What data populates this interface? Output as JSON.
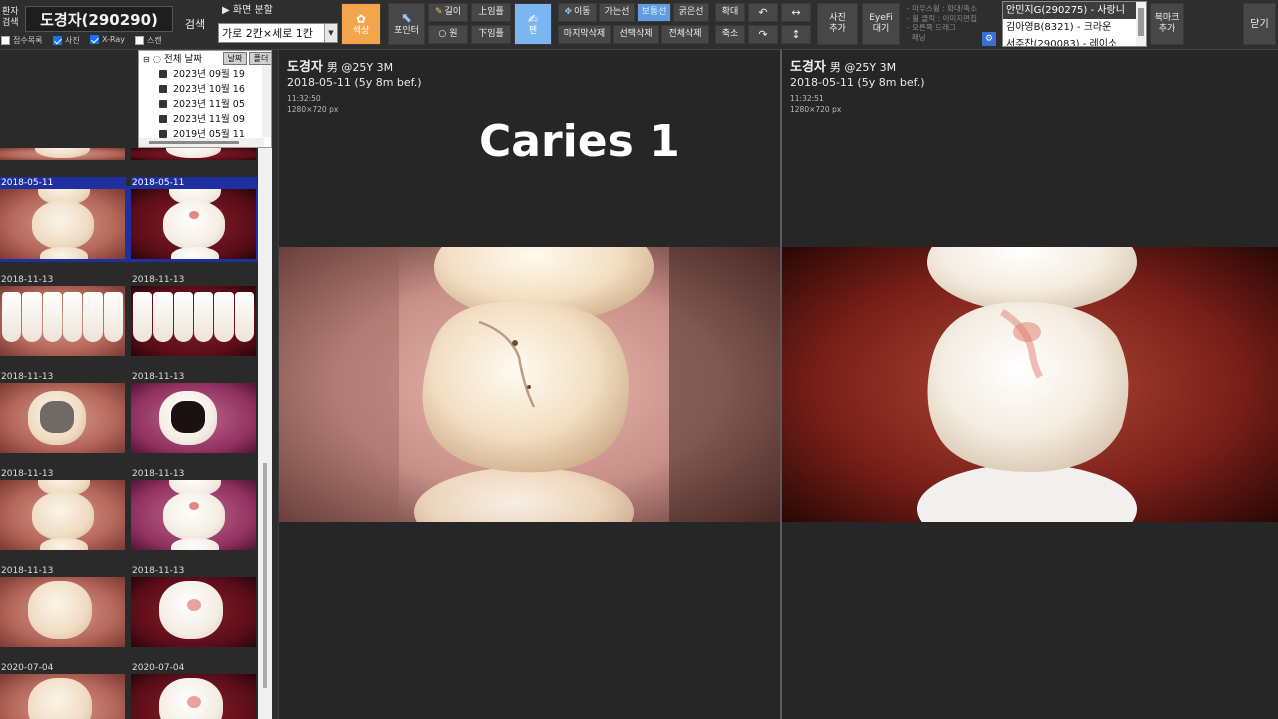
{
  "toolbar": {
    "patient_search_label": "환자\n검색",
    "patient_name": "도경자(290290)",
    "search_button": "검색",
    "checkboxes": [
      {
        "label": "접수목록",
        "checked": false
      },
      {
        "label": "사진",
        "checked": true
      },
      {
        "label": "X-Ray",
        "checked": true
      },
      {
        "label": "스캔",
        "checked": false
      }
    ],
    "split_label": "▶ 화면 분할",
    "split_value": "가로 2칸×세로 1칸",
    "color_button": "색상",
    "pointer_button": "포인터",
    "length_button": "길이",
    "circle_button": "원",
    "up_open_button": "上임플",
    "down_open_button": "下임플",
    "pen_button": "펜",
    "move_button": "이동",
    "thin_line_button": "가는선",
    "normal_line_button": "보통선",
    "thick_line_button": "굵은선",
    "delete_last_button": "마지막삭제",
    "delete_selected_button": "선택삭제",
    "delete_all_button": "전체삭제",
    "zoom_in_button": "확대",
    "zoom_out_button": "축소",
    "rotate_ccw_glyph": "↶",
    "rotate_cw_glyph": "↷",
    "flip_h_glyph": "↔",
    "flip_v_glyph": "↕",
    "add_photo_button": "사진\n추가",
    "eyefi_button": "EyeFi\n대기",
    "hint_lines": [
      "- 마우스휠 : 확대/축소",
      "- 휠 클릭 : 이미지편집",
      "- 오른쪽 드래그",
      "  패닝"
    ],
    "hint_gear_glyph": "⚙",
    "queue": [
      {
        "label": "안민지G(290275) - 사랑니",
        "selected": true
      },
      {
        "label": "김아영B(8321) - 크라운",
        "selected": false
      },
      {
        "label": "서주찬(290083) - 레이소",
        "selected": false
      }
    ],
    "bookmark_button": "북마크\n추가",
    "close_button": "닫기"
  },
  "date_tree": {
    "root_label": "전체 날짜",
    "tab_date": "날짜",
    "tab_folder": "폴더",
    "nodes": [
      "2023년 09월 19",
      "2023년 10월 16",
      "2023년 11월 05",
      "2023년 11월 09",
      "2019년 05월 11"
    ]
  },
  "thumbnails": [
    {
      "date": "2018-05-11",
      "selected": true,
      "kind": "molar",
      "variant": "light"
    },
    {
      "date": "2018-05-11",
      "selected": true,
      "kind": "molar",
      "variant": "dark"
    },
    {
      "date": "2018-11-13",
      "selected": false,
      "kind": "front",
      "variant": "light"
    },
    {
      "date": "2018-11-13",
      "selected": false,
      "kind": "front",
      "variant": "dark"
    },
    {
      "date": "2018-11-13",
      "selected": false,
      "kind": "amalgam",
      "variant": "light"
    },
    {
      "date": "2018-11-13",
      "selected": false,
      "kind": "amalgam",
      "variant": "purple"
    },
    {
      "date": "2018-11-13",
      "selected": false,
      "kind": "molar",
      "variant": "light"
    },
    {
      "date": "2018-11-13",
      "selected": false,
      "kind": "molar",
      "variant": "purple"
    },
    {
      "date": "2018-11-13",
      "selected": false,
      "kind": "single",
      "variant": "light"
    },
    {
      "date": "2018-11-13",
      "selected": false,
      "kind": "single",
      "variant": "dark"
    },
    {
      "date": "2020-07-04",
      "selected": false,
      "kind": "single",
      "variant": "light"
    },
    {
      "date": "2020-07-04",
      "selected": false,
      "kind": "single",
      "variant": "dark"
    }
  ],
  "viewer_left": {
    "patient": "도경자",
    "details": "男 @25Y 3M",
    "date": "2018-05-11 (5y 8m bef.)",
    "time": "11:32:50",
    "size": "1280×720 px",
    "annotation": "Caries 1"
  },
  "viewer_right": {
    "patient": "도경자",
    "details": "男 @25Y 3M",
    "date": "2018-05-11 (5y 8m bef.)",
    "time": "11:32:51",
    "size": "1280×720 px"
  },
  "colors": {
    "accent_orange": "#f2a54a",
    "accent_blue": "#7cb6f2",
    "selection_blue": "#1e2fa0"
  }
}
